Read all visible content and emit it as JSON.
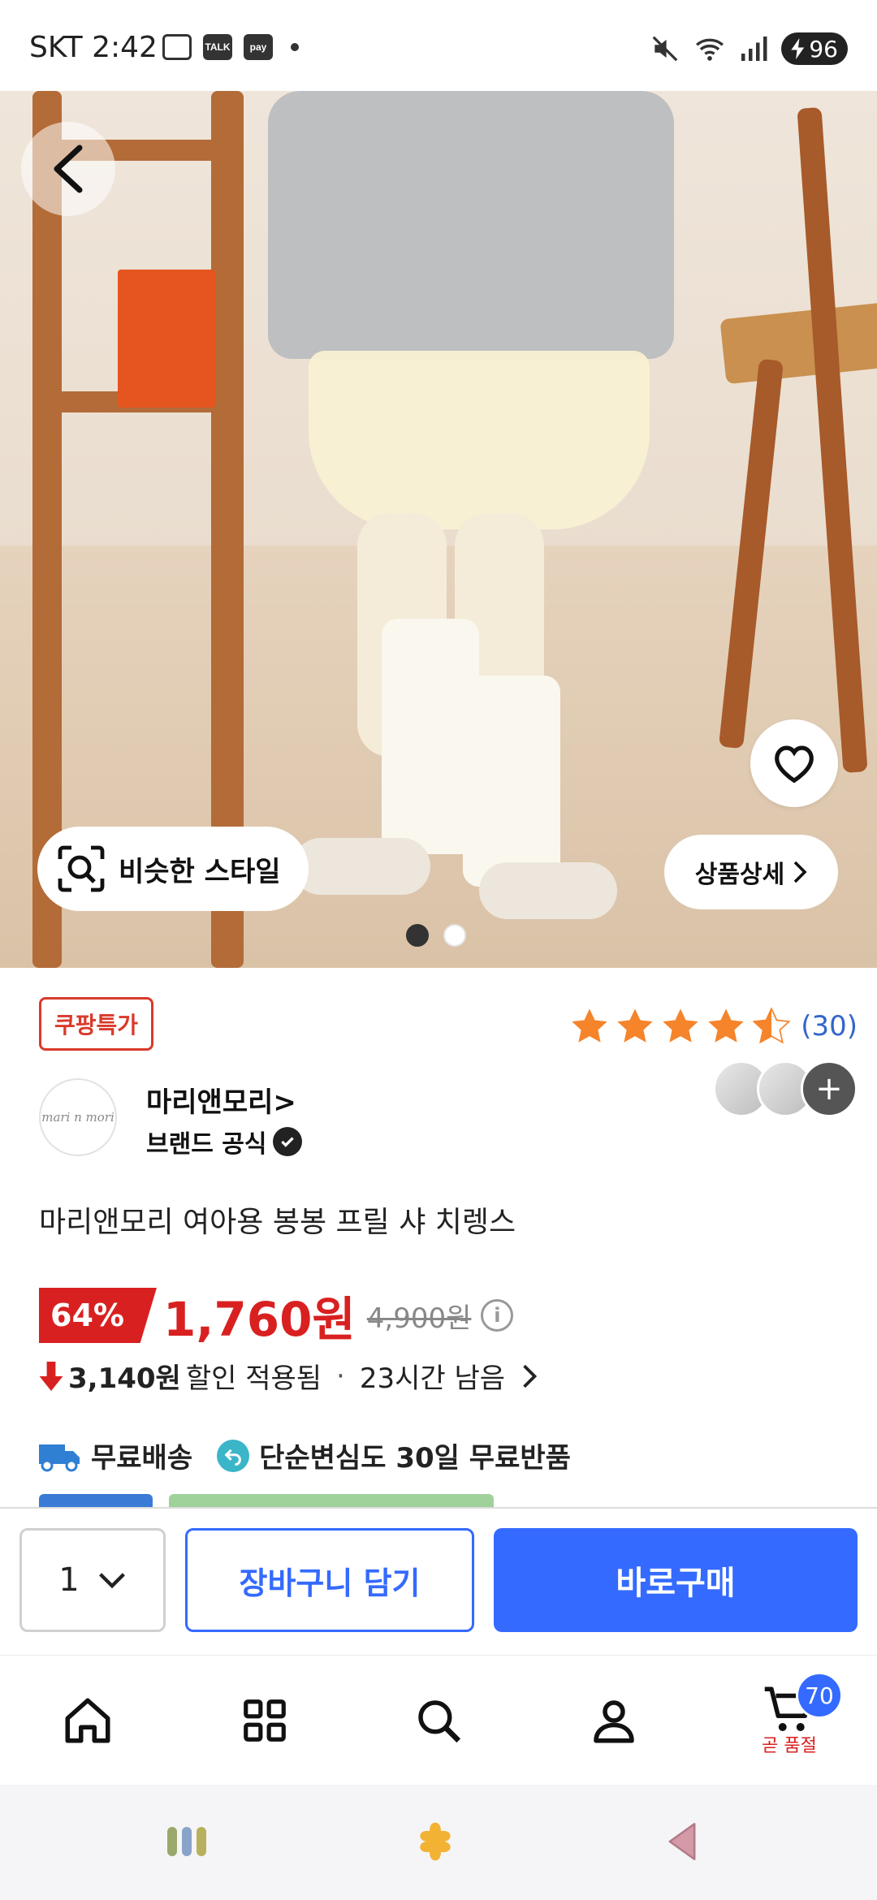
{
  "status_bar": {
    "time": "SKT 2:42",
    "talk_label": "TALK",
    "pay_label": "pay",
    "battery": "96"
  },
  "hero": {
    "similar_style_label": "비슷한 스타일",
    "product_detail_label": "상품상세",
    "page_count": 2,
    "active_page": 1
  },
  "product": {
    "special_badge": "쿠팡특가",
    "rating_value": 4.5,
    "rating_count": "(30)",
    "seller_name": "마리앤모리>",
    "seller_official": "브랜드 공식",
    "seller_logo_text": "mari n mori",
    "title": "마리앤모리 여아용 봉봉 프릴 샤 치렝스",
    "discount": "64%",
    "sale_price": "1,760원",
    "original_price": "4,900원",
    "coupon_amount": "3,140원",
    "coupon_text": "할인 적용됨",
    "time_left": "23시간 남음",
    "shipping": "무료배송",
    "returns": "단순변심도 30일 무료반품"
  },
  "purchase_bar": {
    "quantity": "1",
    "add_to_cart": "장바구니 담기",
    "buy_now": "바로구매"
  },
  "bottom_nav": {
    "cart_count": "70",
    "cart_note": "곧 품절"
  },
  "colors": {
    "brand_blue": "#346aff",
    "sale_red": "#d92020",
    "star_orange": "#f5842b"
  }
}
